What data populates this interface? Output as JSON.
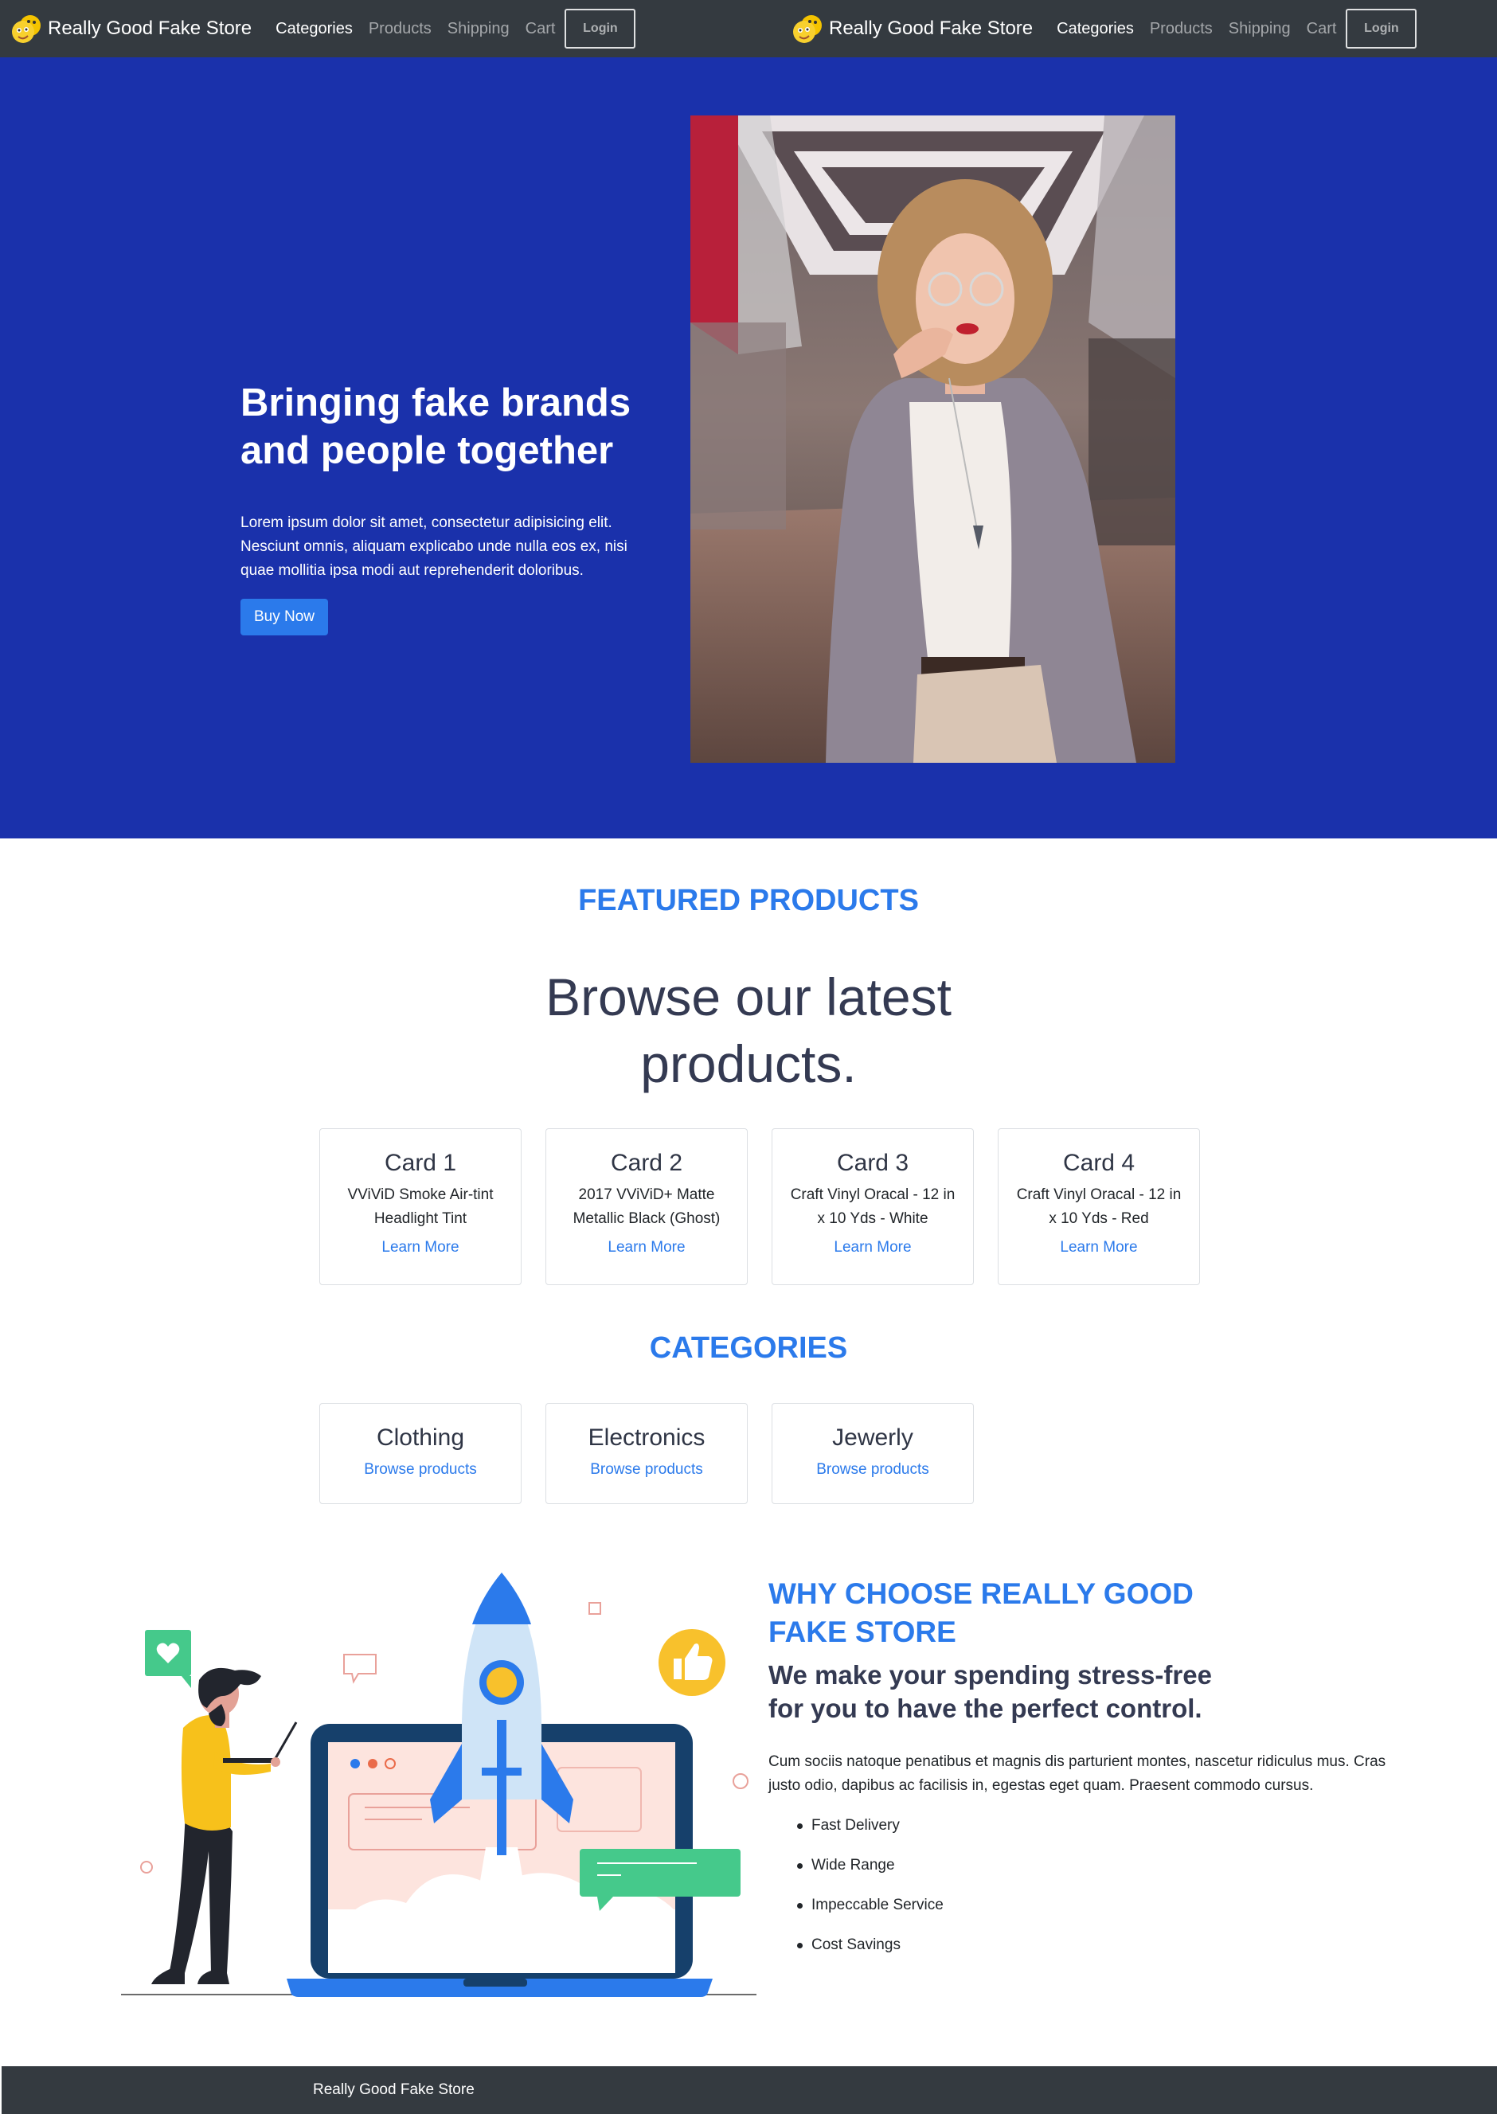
{
  "nav": {
    "brand": "Really Good Fake Store",
    "links": [
      "Categories",
      "Products",
      "Shipping",
      "Cart"
    ],
    "login": "Login"
  },
  "hero": {
    "title": "Bringing fake brands and people together",
    "text": "Lorem ipsum dolor sit amet, consectetur adipisicing elit. Nesciunt omnis, aliquam explicabo unde nulla eos ex, nisi quae mollitia ipsa modi aut reprehenderit doloribus.",
    "button": "Buy Now"
  },
  "featured": {
    "kicker": "FEATURED PRODUCTS",
    "title": "Browse our latest products.",
    "cards": [
      {
        "title": "Card 1",
        "text": "VViViD Smoke Air-tint Headlight Tint",
        "link": "Learn More"
      },
      {
        "title": "Card 2",
        "text": "2017 VViViD+ Matte Metallic Black (Ghost)",
        "link": "Learn More"
      },
      {
        "title": "Card 3",
        "text": "Craft Vinyl Oracal - 12 in x 10 Yds - White",
        "link": "Learn More"
      },
      {
        "title": "Card 4",
        "text": "Craft Vinyl Oracal - 12 in x 10 Yds - Red",
        "link": "Learn More"
      }
    ]
  },
  "categories": {
    "kicker": "CATEGORIES",
    "items": [
      {
        "title": "Clothing",
        "link": "Browse products"
      },
      {
        "title": "Electronics",
        "link": "Browse products"
      },
      {
        "title": "Jewerly",
        "link": "Browse products"
      }
    ]
  },
  "why": {
    "kicker": "WHY CHOOSE REALLY GOOD FAKE STORE",
    "subtitle": "We make your spending stress-free for you to have the perfect control.",
    "text": "Cum sociis natoque penatibus et magnis dis parturient montes, nascetur ridiculus mus. Cras justo odio, dapibus ac facilisis in, egestas eget quam. Praesent commodo cursus.",
    "list": [
      "Fast Delivery",
      "Wide Range",
      "Impeccable Service",
      "Cost Savings"
    ]
  },
  "footer": {
    "text": "Really Good Fake Store"
  },
  "colors": {
    "navbar": "#343a40",
    "hero": "#1a31ab",
    "accent": "#2b7aeb",
    "heading": "#343a52"
  },
  "icons": [
    "store-logo-icon",
    "heart-icon",
    "thumbs-up-icon",
    "rocket-icon",
    "laptop-icon",
    "chat-bubble-icon"
  ]
}
